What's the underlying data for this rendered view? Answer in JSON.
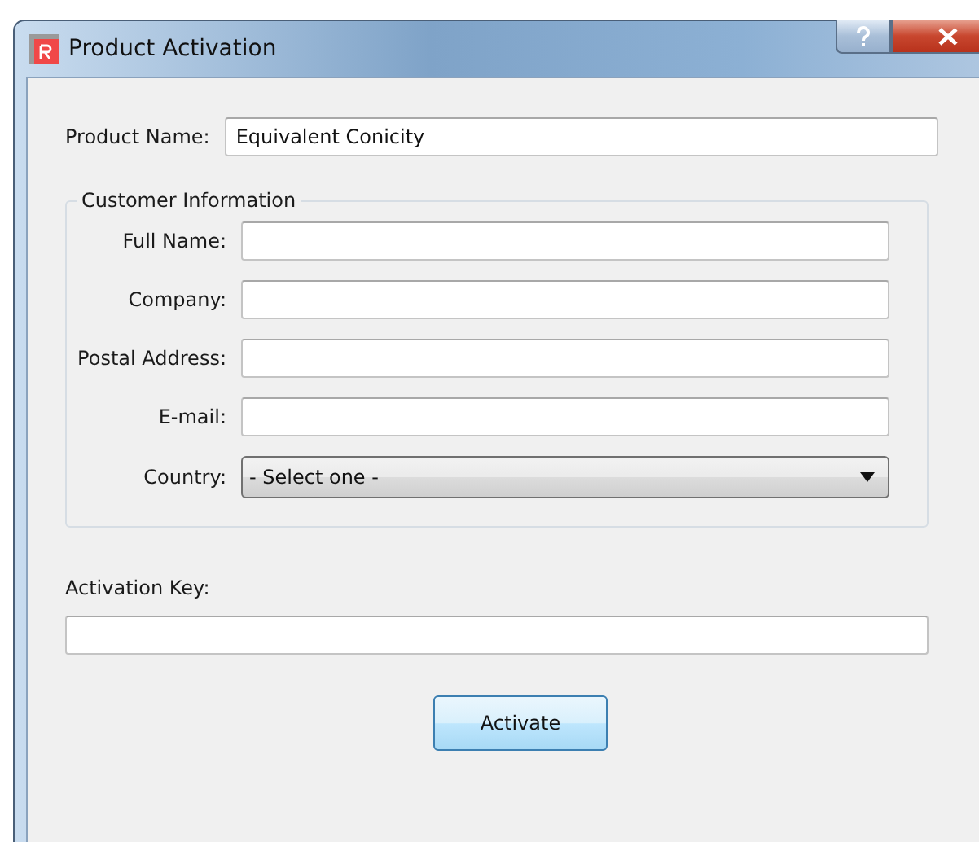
{
  "window": {
    "title": "Product Activation"
  },
  "product_name": {
    "label": "Product Name:",
    "value": "Equivalent Conicity"
  },
  "customer_information": {
    "title": "Customer Information",
    "fields": [
      {
        "label": "Full Name:",
        "kind": "text"
      },
      {
        "label": "Company:",
        "kind": "text"
      },
      {
        "label": "Postal Address:",
        "kind": "text"
      },
      {
        "label": "E-mail:",
        "kind": "text"
      },
      {
        "label": "Country:",
        "kind": "select",
        "value": "- Select one -"
      }
    ]
  },
  "activation_key": {
    "label": "Activation Key:"
  },
  "button": {
    "label": "Activate"
  }
}
